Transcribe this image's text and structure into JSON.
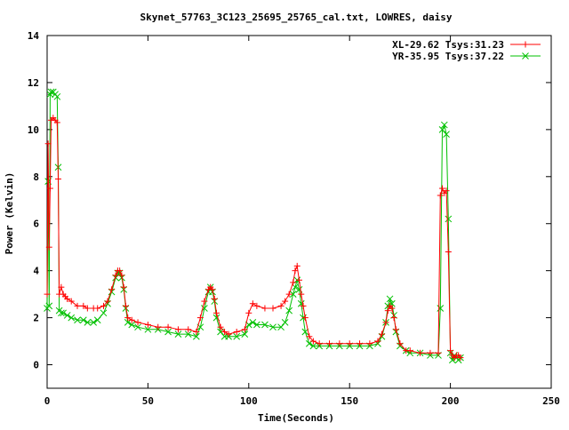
{
  "chart_data": {
    "type": "line",
    "title": "Skynet_57763_3C123_25695_25765_cal.txt, LOWRES, daisy",
    "xlabel": "Time(Seconds)",
    "ylabel": "Power (Kelvin)",
    "xlim": [
      0,
      250
    ],
    "ylim": [
      -1,
      14
    ],
    "x_ticks": [
      0,
      50,
      100,
      150,
      200,
      250
    ],
    "y_ticks": [
      0,
      2,
      4,
      6,
      8,
      10,
      12,
      14
    ],
    "grid": false,
    "legend_position": "top-right",
    "series": [
      {
        "name": "XL-29.62 Tsys:31.23",
        "color": "#ff0000",
        "marker": "plus",
        "x": [
          0,
          0.5,
          1,
          1.5,
          2,
          3,
          4,
          5,
          5.5,
          6,
          7,
          8,
          9,
          10,
          12,
          15,
          18,
          20,
          23,
          25,
          28,
          30,
          32,
          34,
          35,
          36,
          37,
          38,
          39,
          40,
          42,
          45,
          50,
          55,
          60,
          65,
          70,
          74,
          76,
          78,
          80,
          81,
          82,
          83,
          84,
          86,
          88,
          90,
          94,
          98,
          100,
          102,
          104,
          108,
          112,
          116,
          118,
          120,
          122,
          123,
          124,
          125,
          126,
          127,
          128,
          130,
          132,
          135,
          140,
          145,
          150,
          155,
          160,
          164,
          166,
          168,
          169,
          170,
          171,
          172,
          173,
          175,
          178,
          180,
          185,
          190,
          194,
          195,
          196,
          197,
          198,
          199,
          200,
          201,
          202,
          203,
          204,
          205
        ],
        "values": [
          3.0,
          9.4,
          5.0,
          7.5,
          10.4,
          10.5,
          10.4,
          10.3,
          7.9,
          3.0,
          3.3,
          3.0,
          2.9,
          2.8,
          2.7,
          2.5,
          2.5,
          2.4,
          2.4,
          2.4,
          2.5,
          2.7,
          3.2,
          3.8,
          4.0,
          4.0,
          3.8,
          3.3,
          2.5,
          2.0,
          1.9,
          1.8,
          1.7,
          1.6,
          1.6,
          1.5,
          1.5,
          1.4,
          2.0,
          2.7,
          3.2,
          3.3,
          3.2,
          2.8,
          2.2,
          1.6,
          1.4,
          1.3,
          1.4,
          1.5,
          2.2,
          2.6,
          2.5,
          2.4,
          2.4,
          2.5,
          2.7,
          3.0,
          3.5,
          4.0,
          4.2,
          3.6,
          3.0,
          2.5,
          2.0,
          1.2,
          1.0,
          0.9,
          0.9,
          0.9,
          0.9,
          0.9,
          0.9,
          1.0,
          1.3,
          1.8,
          2.3,
          2.5,
          2.4,
          2.0,
          1.5,
          0.9,
          0.6,
          0.6,
          0.5,
          0.5,
          0.5,
          7.2,
          7.5,
          7.3,
          7.4,
          4.8,
          0.6,
          0.4,
          0.3,
          0.4,
          0.4,
          0.3
        ]
      },
      {
        "name": "YR-35.95 Tsys:37.22",
        "color": "#00c000",
        "marker": "x",
        "x": [
          0,
          0.5,
          1,
          1.5,
          2,
          3,
          4,
          5,
          5.5,
          6,
          7,
          8,
          10,
          12,
          15,
          18,
          20,
          23,
          25,
          28,
          30,
          32,
          34,
          35,
          36,
          37,
          38,
          39,
          40,
          42,
          45,
          50,
          55,
          60,
          65,
          70,
          74,
          76,
          78,
          80,
          81,
          82,
          83,
          84,
          86,
          88,
          90,
          94,
          98,
          100,
          102,
          104,
          108,
          112,
          116,
          118,
          120,
          122,
          123,
          124,
          125,
          126,
          127,
          128,
          130,
          132,
          135,
          140,
          145,
          150,
          155,
          160,
          164,
          166,
          168,
          169,
          170,
          171,
          172,
          173,
          175,
          178,
          180,
          185,
          190,
          194,
          195,
          196,
          197,
          198,
          199,
          200,
          201,
          202,
          203,
          204,
          205
        ],
        "values": [
          2.4,
          7.8,
          2.5,
          11.5,
          11.6,
          11.6,
          11.5,
          11.4,
          8.4,
          2.3,
          2.2,
          2.2,
          2.1,
          2.0,
          1.9,
          1.9,
          1.8,
          1.8,
          1.9,
          2.2,
          2.6,
          3.1,
          3.7,
          3.9,
          3.9,
          3.7,
          3.2,
          2.4,
          1.8,
          1.7,
          1.6,
          1.5,
          1.5,
          1.4,
          1.3,
          1.3,
          1.2,
          1.6,
          2.4,
          3.1,
          3.3,
          3.1,
          2.7,
          2.0,
          1.4,
          1.2,
          1.2,
          1.2,
          1.3,
          1.7,
          1.8,
          1.7,
          1.7,
          1.6,
          1.6,
          1.8,
          2.3,
          3.0,
          3.3,
          3.6,
          3.2,
          2.6,
          2.0,
          1.4,
          0.9,
          0.8,
          0.8,
          0.8,
          0.8,
          0.8,
          0.8,
          0.8,
          0.9,
          1.2,
          1.8,
          2.5,
          2.8,
          2.6,
          2.1,
          1.4,
          0.8,
          0.6,
          0.5,
          0.5,
          0.4,
          0.4,
          2.4,
          10.0,
          10.2,
          9.8,
          6.2,
          0.5,
          0.2,
          0.4,
          0.3,
          0.2,
          0.3
        ]
      }
    ]
  }
}
